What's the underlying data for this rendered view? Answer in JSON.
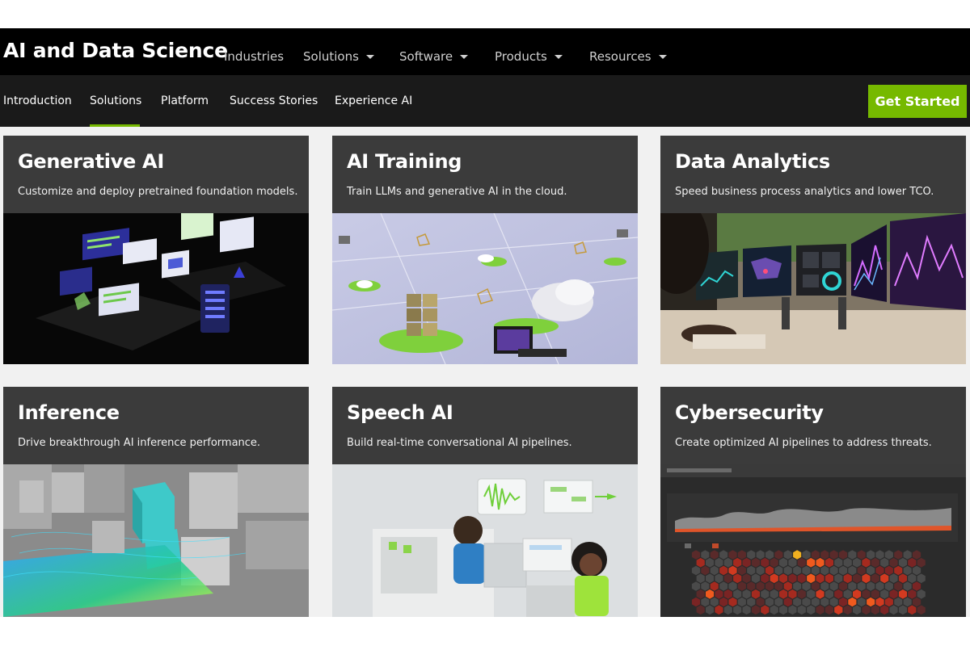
{
  "header": {
    "brand": "AI and Data Science",
    "nav": [
      {
        "label": "Industries",
        "dropdown": false
      },
      {
        "label": "Solutions",
        "dropdown": true
      },
      {
        "label": "Software",
        "dropdown": true
      },
      {
        "label": "Products",
        "dropdown": true
      },
      {
        "label": "Resources",
        "dropdown": true
      }
    ]
  },
  "subnav": {
    "items": [
      "Introduction",
      "Solutions",
      "Platform",
      "Success Stories",
      "Experience AI"
    ],
    "active": "Solutions",
    "cta": "Get Started"
  },
  "colors": {
    "accent": "#76b900",
    "topbar": "#000000",
    "subbar": "#1a1a1a",
    "card": "#3b3b3b"
  },
  "cards": [
    {
      "title": "Generative AI",
      "description": "Customize and deploy pretrained foundation models."
    },
    {
      "title": "AI Training",
      "description": "Train LLMs and generative AI in the cloud."
    },
    {
      "title": "Data Analytics",
      "description": "Speed business process analytics and lower TCO."
    },
    {
      "title": "Inference",
      "description": "Drive breakthrough AI inference performance."
    },
    {
      "title": "Speech AI",
      "description": "Build real-time conversational AI pipelines."
    },
    {
      "title": "Cybersecurity",
      "description": "Create optimized AI pipelines to address threats."
    }
  ]
}
